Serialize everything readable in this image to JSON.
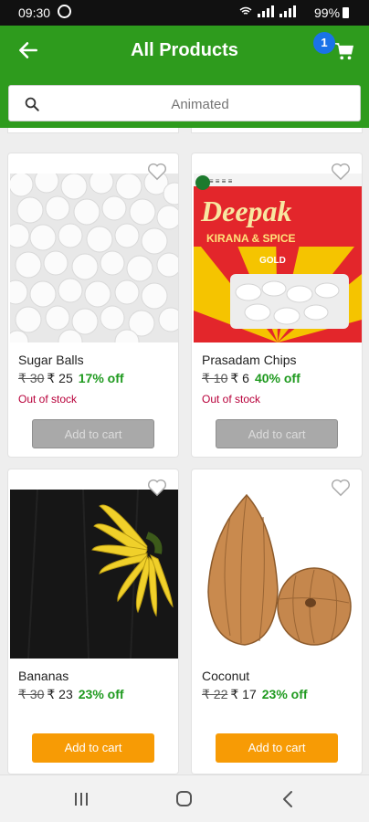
{
  "status_bar": {
    "time": "09:30",
    "battery": "99%"
  },
  "app_bar": {
    "title": "All Products",
    "cart_count": "1"
  },
  "search": {
    "placeholder": "Animated"
  },
  "products": [
    {
      "name": "Sugar Balls",
      "mrp": "₹ 30",
      "price": "₹ 25",
      "discount": "17% off",
      "stock_status": "Out of stock",
      "button_label": "Add to cart",
      "in_stock": false,
      "image": "sugar-balls-image"
    },
    {
      "name": "Prasadam Chips",
      "mrp": "₹ 10",
      "price": "₹ 6",
      "discount": "40% off",
      "stock_status": "Out of stock",
      "button_label": "Add to cart",
      "in_stock": false,
      "image": "prasadam-chips-image",
      "package_text": {
        "brand": "Deepak",
        "tagline": "KIRANA & SPICE",
        "variant": "GOLD"
      }
    },
    {
      "name": "Bananas",
      "mrp": "₹ 30",
      "price": "₹ 23",
      "discount": "23% off",
      "stock_status": "",
      "button_label": "Add to cart",
      "in_stock": true,
      "image": "bananas-image"
    },
    {
      "name": "Coconut",
      "mrp": "₹ 22",
      "price": "₹ 17",
      "discount": "23% off",
      "stock_status": "",
      "button_label": "Add to cart",
      "in_stock": true,
      "image": "coconut-image"
    }
  ],
  "colors": {
    "primary": "#2e9b1d",
    "add_to_cart": "#f79b05",
    "discount": "#1f9a1f",
    "out_of_stock": "#b8003a",
    "badge": "#1a73e8"
  }
}
